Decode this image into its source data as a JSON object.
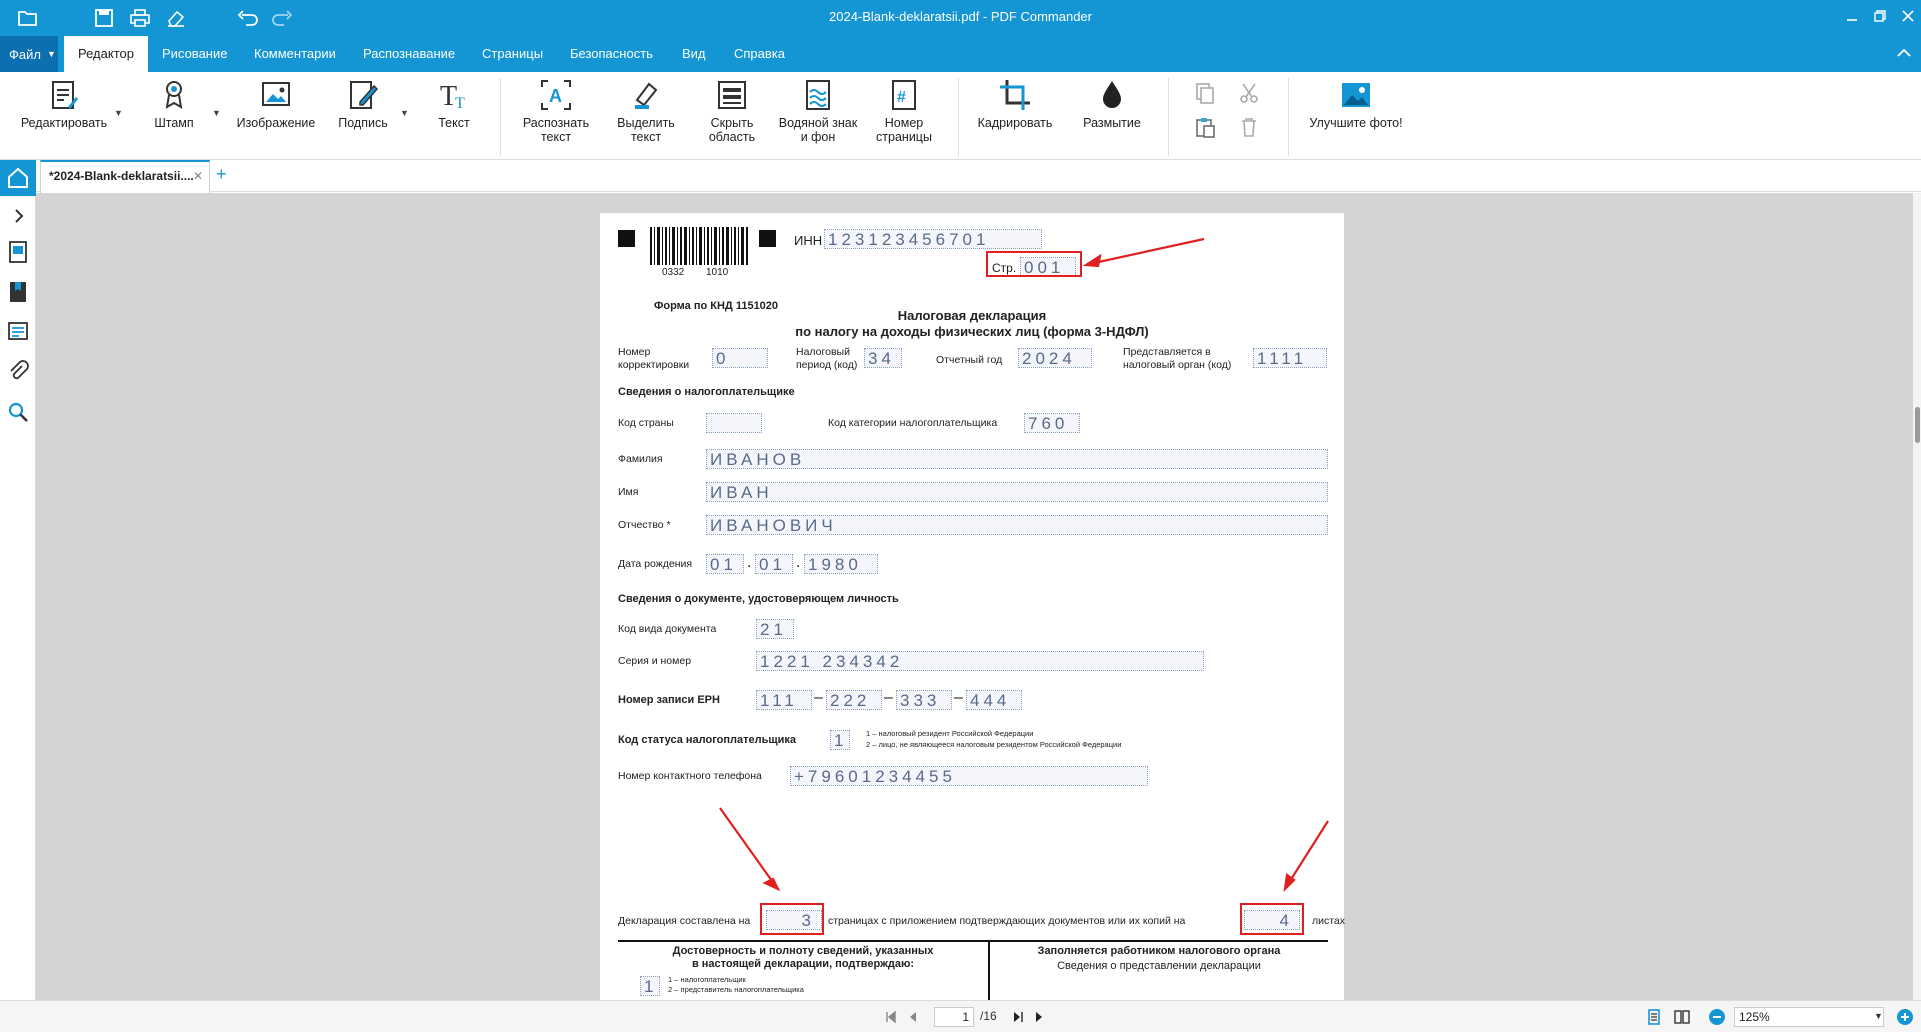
{
  "window": {
    "title": "2024-Blank-deklaratsii.pdf - PDF Commander"
  },
  "menu": {
    "file": "Файл",
    "tabs": [
      "Редактор",
      "Рисование",
      "Комментарии",
      "Распознавание",
      "Страницы",
      "Безопасность",
      "Вид",
      "Справка"
    ]
  },
  "ribbon": {
    "edit": "Редактировать",
    "stamp": "Штамп",
    "image": "Изображение",
    "sign": "Подпись",
    "text": "Текст",
    "recognize_1": "Распознать",
    "recognize_2": "текст",
    "highlight_1": "Выделить",
    "highlight_2": "текст",
    "hide_1": "Скрыть",
    "hide_2": "область",
    "watermark_1": "Водяной знак",
    "watermark_2": "и фон",
    "pagenum_1": "Номер",
    "pagenum_2": "страницы",
    "crop": "Кадрировать",
    "blur": "Размытие",
    "enhance": "Улучшите фото!"
  },
  "tabs": {
    "doc": "*2024-Blank-deklaratsii...."
  },
  "doc": {
    "inn_label": "ИНН",
    "inn": "123123456701",
    "barcode_1": "0332",
    "barcode_2": "1010",
    "page_label": "Стр.",
    "page_num": "001",
    "knd": "Форма по КНД 1151020",
    "title_1": "Налоговая декларация",
    "title_2": "по налогу на доходы физических лиц (форма 3-НДФЛ)",
    "corr_1": "Номер",
    "corr_2": "корректировки",
    "corr_val": "0",
    "period_1": "Налоговый",
    "period_2": "период (код)",
    "period_val": "34",
    "year_label": "Отчетный год",
    "year_val": "2024",
    "organ_1": "Представляется в",
    "organ_2": "налоговый орган (код)",
    "organ_val": "1111",
    "taxpayer_header": "Сведения о налогоплательщике",
    "country_label": "Код страны",
    "category_label": "Код категории налогоплательщика",
    "category_val": "760",
    "surname_label": "Фамилия",
    "surname_val": "ИВАНОВ",
    "name_label": "Имя",
    "name_val": "ИВАН",
    "patronymic_label": "Отчество *",
    "patronymic_val": "ИВАНОВИЧ",
    "birth_label": "Дата рождения",
    "birth_d": "01",
    "birth_m": "01",
    "birth_y": "1980",
    "id_header": "Сведения о документе, удостоверяющем личность",
    "doctype_label": "Код вида документа",
    "doctype_val": "21",
    "series_label": "Серия и номер",
    "series_val": "1221 234342",
    "ern_label": "Номер записи ЕРН",
    "ern_1": "111",
    "ern_2": "222",
    "ern_3": "333",
    "ern_4": "444",
    "status_label": "Код статуса налогоплательщика",
    "status_val": "1",
    "status_note_1": "1 – налоговый резидент Российской Федерации",
    "status_note_2": "2 – лицо, не являющееся налоговым резидентом Российской Федерации",
    "phone_label": "Номер контактного телефона",
    "phone_val": "+79601234455",
    "compiled_1": "Декларация составлена на",
    "pages_val": "3",
    "compiled_2": "страницах с приложением подтверждающих документов или их копий на",
    "sheets_val": "4",
    "compiled_3": "листах",
    "confirm_1": "Достоверность и полноту сведений, указанных",
    "confirm_2": "в настоящей декларации, подтверждаю:",
    "confirm_val": "1",
    "confirm_note_1": "1 – налогоплательщик",
    "confirm_note_2": "2 – представитель налогоплательщика",
    "organ_header_1": "Заполняется работником налогового органа",
    "organ_header_2": "Сведения о представлении декларации"
  },
  "status": {
    "page": "1",
    "total": "/16",
    "zoom": "125%"
  },
  "colors": {
    "accent": "#1596d4",
    "highlight": "#e02020",
    "field_text": "#5a6a8a"
  }
}
